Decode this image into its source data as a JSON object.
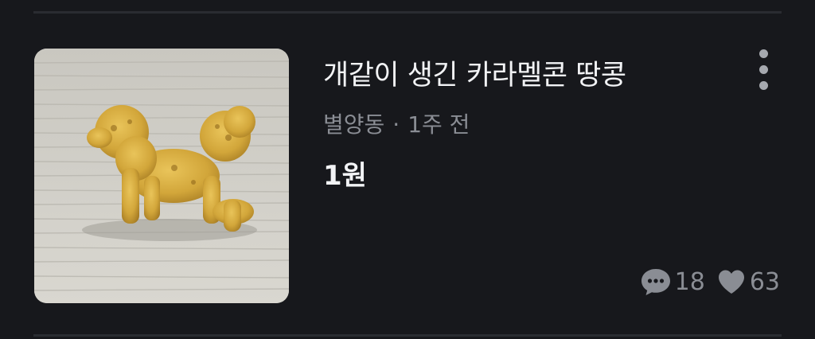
{
  "listing": {
    "title": "개같이 생긴 카라멜콘 땅콩",
    "location": "별양동",
    "separator": "·",
    "posted_time": "1주 전",
    "price": "1원",
    "chat_count": "18",
    "like_count": "63",
    "thumbnail_alt": "dog-shaped caramel corn snack",
    "icons": {
      "more": "more-vertical-icon",
      "chat": "chat-bubble-icon",
      "like": "heart-icon"
    }
  },
  "colors": {
    "background": "#17181c",
    "title": "#f2f3f5",
    "meta": "#8a8d94",
    "divider": "#2a2c31"
  }
}
